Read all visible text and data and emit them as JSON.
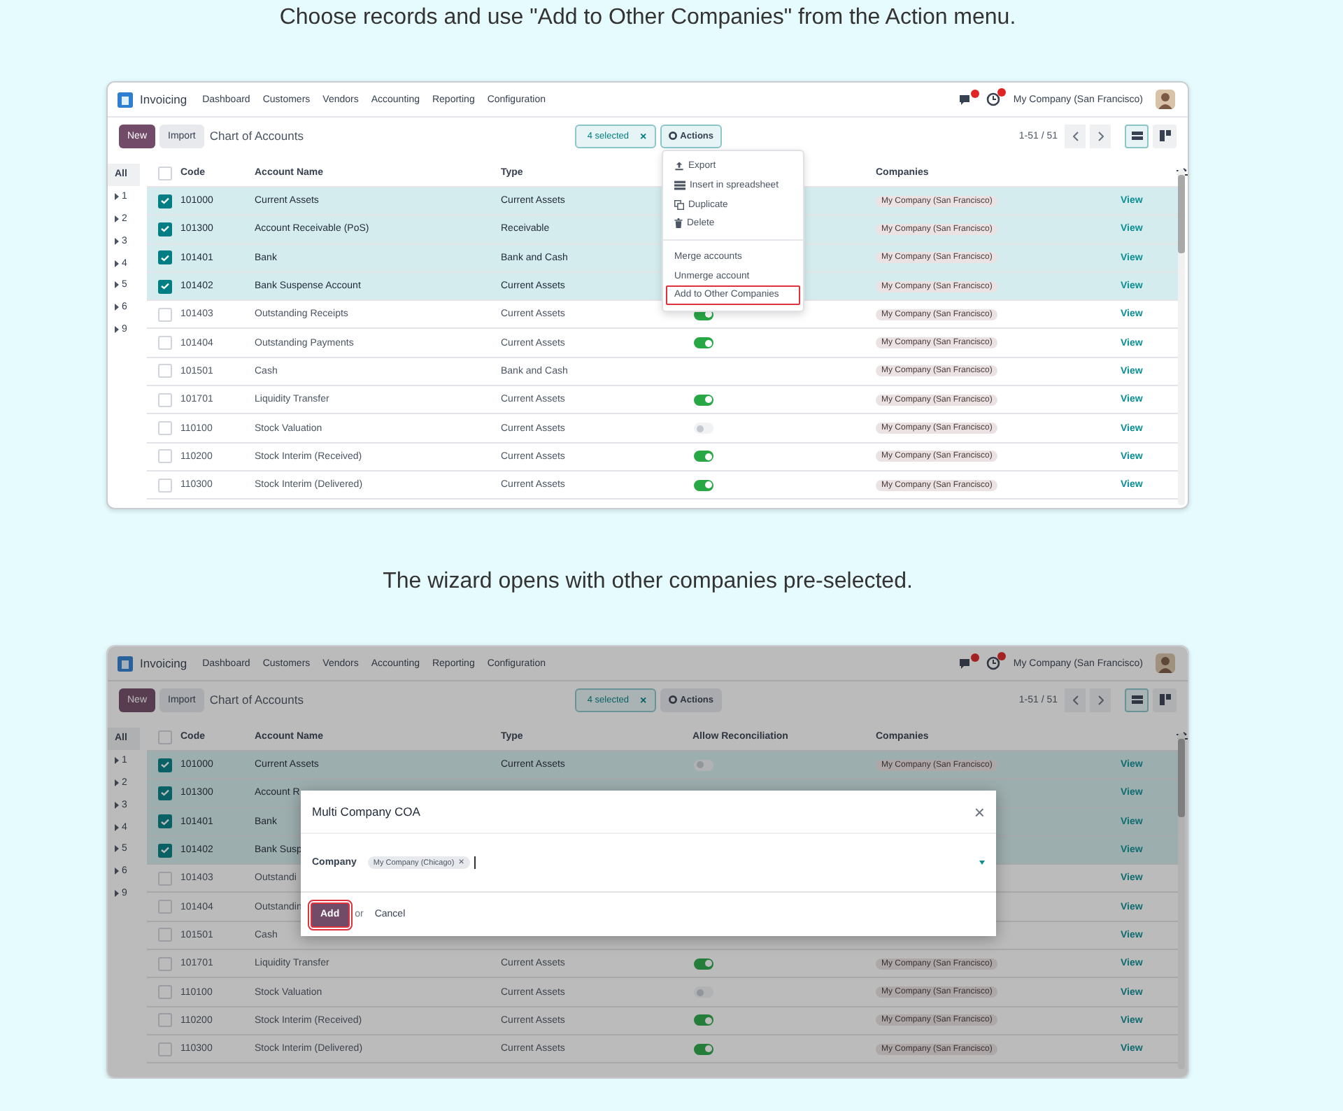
{
  "steps": [
    {
      "caption": "Choose records and use \"Add to Other Companies\" from the Action menu.",
      "screen": {
        "navbar": {
          "app": "Invoicing",
          "menu": [
            "Dashboard",
            "Customers",
            "Vendors",
            "Accounting",
            "Reporting",
            "Configuration"
          ],
          "company": "My Company (San Francisco)"
        },
        "control_panel": {
          "new": "New",
          "import": "Import",
          "title": "Chart of Accounts",
          "selection": "4 selected",
          "clear": "×",
          "actions": "Actions",
          "actions_open": true,
          "pager": "1-51 / 51",
          "views": [
            {
              "kind": "list",
              "selected": true
            },
            {
              "kind": "kanban",
              "selected": false
            }
          ]
        },
        "sidebar": [
          {
            "kind": "all",
            "label": "All",
            "selected": true
          },
          {
            "kind": "group",
            "label": "1",
            "selected": false
          },
          {
            "kind": "group",
            "label": "2",
            "selected": false
          },
          {
            "kind": "group",
            "label": "3",
            "selected": false
          },
          {
            "kind": "group",
            "label": "4",
            "selected": false
          },
          {
            "kind": "group",
            "label": "5",
            "selected": false
          },
          {
            "kind": "group",
            "label": "6",
            "selected": false
          },
          {
            "kind": "group",
            "label": "9",
            "selected": false
          }
        ],
        "select_all": {
          "checked": false
        },
        "columns": {
          "code": "Code",
          "name": "Account Name",
          "type": "Type",
          "companies": "Companies"
        },
        "rows": [
          {
            "selected": true,
            "code": "101000",
            "name": "Current Assets",
            "type": "Current Assets",
            "company": "My Company (San Francisco)",
            "action": "View"
          },
          {
            "selected": true,
            "code": "101300",
            "name": "Account Receivable (PoS)",
            "type": "Receivable",
            "company": "My Company (San Francisco)",
            "action": "View"
          },
          {
            "selected": true,
            "code": "101401",
            "name": "Bank",
            "type": "Bank and Cash",
            "company": "My Company (San Francisco)",
            "action": "View"
          },
          {
            "selected": true,
            "code": "101402",
            "name": "Bank Suspense Account",
            "type": "Current Assets",
            "company": "My Company (San Francisco)",
            "action": "View"
          },
          {
            "selected": false,
            "code": "101403",
            "name": "Outstanding Receipts",
            "type": "Current Assets",
            "reconcile": true,
            "company": "My Company (San Francisco)",
            "action": "View"
          },
          {
            "selected": false,
            "code": "101404",
            "name": "Outstanding Payments",
            "type": "Current Assets",
            "reconcile": true,
            "company": "My Company (San Francisco)",
            "action": "View"
          },
          {
            "selected": false,
            "code": "101501",
            "name": "Cash",
            "type": "Bank and Cash",
            "company": "My Company (San Francisco)",
            "action": "View"
          },
          {
            "selected": false,
            "code": "101701",
            "name": "Liquidity Transfer",
            "type": "Current Assets",
            "reconcile": true,
            "company": "My Company (San Francisco)",
            "action": "View"
          },
          {
            "selected": false,
            "code": "110100",
            "name": "Stock Valuation",
            "type": "Current Assets",
            "reconcile": false,
            "company": "My Company (San Francisco)",
            "action": "View"
          },
          {
            "selected": false,
            "code": "110200",
            "name": "Stock Interim (Received)",
            "type": "Current Assets",
            "reconcile": true,
            "company": "My Company (San Francisco)",
            "action": "View"
          },
          {
            "selected": false,
            "code": "110300",
            "name": "Stock Interim (Delivered)",
            "type": "Current Assets",
            "reconcile": true,
            "company": "My Company (San Francisco)",
            "action": "View"
          }
        ],
        "actions_menu": [
          [
            {
              "kind": "export",
              "label": "Export",
              "highlighted": false
            },
            {
              "kind": "spreadsheet",
              "label": "Insert in spreadsheet",
              "highlighted": false
            },
            {
              "kind": "duplicate",
              "label": "Duplicate",
              "highlighted": false
            },
            {
              "kind": "delete",
              "label": "Delete",
              "highlighted": false
            }
          ],
          [
            {
              "kind": "plain",
              "label": "Merge accounts",
              "highlighted": false
            },
            {
              "kind": "plain",
              "label": "Unmerge account",
              "highlighted": false
            },
            {
              "kind": "plain",
              "label": "Add to Other Companies",
              "highlighted": true
            }
          ]
        ]
      }
    },
    {
      "caption": "The wizard opens with other companies pre-selected.",
      "screen": {
        "navbar": {
          "app": "Invoicing",
          "menu": [
            "Dashboard",
            "Customers",
            "Vendors",
            "Accounting",
            "Reporting",
            "Configuration"
          ],
          "company": "My Company (San Francisco)"
        },
        "control_panel": {
          "new": "New",
          "import": "Import",
          "title": "Chart of Accounts",
          "selection": "4 selected",
          "clear": "×",
          "actions": "Actions",
          "actions_open": false,
          "pager": "1-51 / 51",
          "views": [
            {
              "kind": "list",
              "selected": true
            },
            {
              "kind": "kanban",
              "selected": false
            }
          ]
        },
        "sidebar": [
          {
            "kind": "all",
            "label": "All",
            "selected": true
          },
          {
            "kind": "group",
            "label": "1",
            "selected": false
          },
          {
            "kind": "group",
            "label": "2",
            "selected": false
          },
          {
            "kind": "group",
            "label": "3",
            "selected": false
          },
          {
            "kind": "group",
            "label": "4",
            "selected": false
          },
          {
            "kind": "group",
            "label": "5",
            "selected": false
          },
          {
            "kind": "group",
            "label": "6",
            "selected": false
          },
          {
            "kind": "group",
            "label": "9",
            "selected": false
          }
        ],
        "select_all": {
          "checked": false
        },
        "columns": {
          "code": "Code",
          "name": "Account Name",
          "type": "Type",
          "reconcile": "Allow Reconciliation",
          "companies": "Companies"
        },
        "rows": [
          {
            "selected": true,
            "code": "101000",
            "name": "Current Assets",
            "type": "Current Assets",
            "reconcile": false,
            "company": "My Company (San Francisco)",
            "action": "View"
          },
          {
            "selected": true,
            "code": "101300",
            "name": "Account R",
            "action": "View"
          },
          {
            "selected": true,
            "code": "101401",
            "name": "Bank",
            "action": "View"
          },
          {
            "selected": true,
            "code": "101402",
            "name": "Bank Susp",
            "action": "View"
          },
          {
            "selected": false,
            "code": "101403",
            "name": "Outstandi",
            "action": "View"
          },
          {
            "selected": false,
            "code": "101404",
            "name": "Outstandin",
            "action": "View"
          },
          {
            "selected": false,
            "code": "101501",
            "name": "Cash",
            "action": "View"
          },
          {
            "selected": false,
            "code": "101701",
            "name": "Liquidity Transfer",
            "type": "Current Assets",
            "reconcile": true,
            "company": "My Company (San Francisco)",
            "action": "View"
          },
          {
            "selected": false,
            "code": "110100",
            "name": "Stock Valuation",
            "type": "Current Assets",
            "reconcile": false,
            "company": "My Company (San Francisco)",
            "action": "View"
          },
          {
            "selected": false,
            "code": "110200",
            "name": "Stock Interim (Received)",
            "type": "Current Assets",
            "reconcile": true,
            "company": "My Company (San Francisco)",
            "action": "View"
          },
          {
            "selected": false,
            "code": "110300",
            "name": "Stock Interim (Delivered)",
            "type": "Current Assets",
            "reconcile": true,
            "company": "My Company (San Francisco)",
            "action": "View"
          }
        ],
        "dialog": {
          "title": "Multi Company COA",
          "close": "×",
          "field_label": "Company",
          "tags": [
            {
              "label": "My Company (Chicago)",
              "remove": "×"
            }
          ],
          "confirm": "Add",
          "confirm_highlighted": true,
          "or": "or",
          "cancel": "Cancel"
        }
      }
    }
  ]
}
